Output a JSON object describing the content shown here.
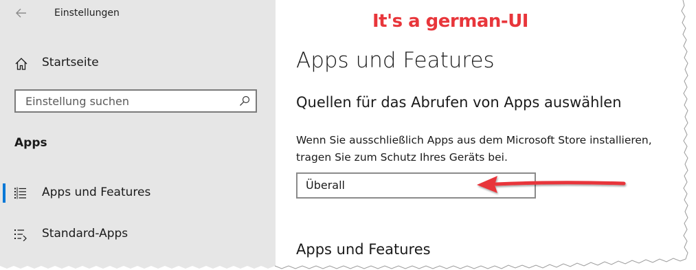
{
  "window": {
    "title": "Einstellungen"
  },
  "sidebar": {
    "home_label": "Startseite",
    "search_placeholder": "Einstellung suchen",
    "section_heading": "Apps",
    "items": [
      {
        "label": "Apps und Features",
        "selected": true,
        "icon": "apps-features-list-icon"
      },
      {
        "label": "Standard-Apps",
        "selected": false,
        "icon": "default-apps-list-icon"
      }
    ]
  },
  "main": {
    "page_title": "Apps und Features",
    "sub_heading": "Quellen für das Abrufen von Apps auswählen",
    "description_line1": "Wenn Sie ausschließlich Apps aus dem Microsoft Store installieren,",
    "description_line2": "tragen Sie zum Schutz Ihres Geräts bei.",
    "source_dropdown_value": "Überall",
    "section2_heading": "Apps und Features"
  },
  "annotation": {
    "text": "It's a german-UI",
    "color": "#e8363b"
  },
  "colors": {
    "sidebar_bg": "#e6e6e6",
    "accent": "#0078d7"
  }
}
